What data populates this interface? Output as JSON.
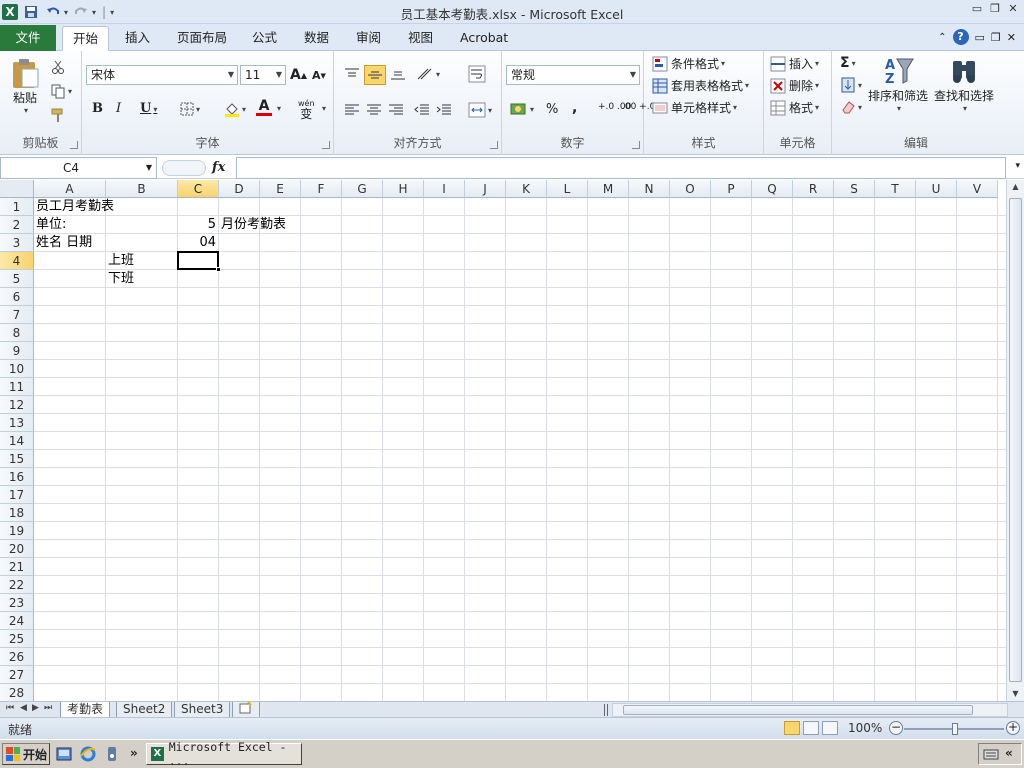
{
  "window": {
    "title": "员工基本考勤表.xlsx - Microsoft Excel"
  },
  "qat": {
    "app_icon": "X",
    "save_icon": "save-icon",
    "undo_icon": "undo-icon",
    "redo_icon": "redo-icon",
    "customize_icon": "customize-icon"
  },
  "tabs": {
    "file": "文件",
    "items": [
      "开始",
      "插入",
      "页面布局",
      "公式",
      "数据",
      "审阅",
      "视图",
      "Acrobat"
    ],
    "active": "开始"
  },
  "ribbon": {
    "clipboard": {
      "label": "剪贴板",
      "paste": "粘贴"
    },
    "font": {
      "label": "字体",
      "name": "宋体",
      "size": "11",
      "bold": "B",
      "italic": "I",
      "underline": "U",
      "grow": "A",
      "shrink": "A",
      "font_color_letter": "A",
      "wen": "wén",
      "wen_glyph": "变"
    },
    "alignment": {
      "label": "对齐方式"
    },
    "number": {
      "label": "数字",
      "format": "常规",
      "percent": "%",
      "comma": ",",
      "inc_dec": "+.0 .00",
      "dec_dec": ".00 +.0"
    },
    "styles": {
      "label": "样式",
      "conditional": "条件格式",
      "table": "套用表格格式",
      "cell_styles": "单元格样式"
    },
    "cells": {
      "label": "单元格",
      "insert": "插入",
      "delete": "删除",
      "format": "格式"
    },
    "editing": {
      "label": "编辑",
      "sigma": "Σ",
      "sort_filter": "排序和筛选",
      "find_select": "查找和选择",
      "az_a": "A",
      "az_z": "Z"
    }
  },
  "formula_bar": {
    "name_box": "C4",
    "fx": "fx",
    "value": ""
  },
  "grid": {
    "columns": [
      "A",
      "B",
      "C",
      "D",
      "E",
      "F",
      "G",
      "H",
      "I",
      "J",
      "K",
      "L",
      "M",
      "N",
      "O",
      "P",
      "Q",
      "R",
      "S",
      "T",
      "U",
      "V"
    ],
    "rows": [
      "1",
      "2",
      "3",
      "4",
      "5",
      "6",
      "7",
      "8",
      "9",
      "10",
      "11",
      "12",
      "13",
      "14",
      "15",
      "16",
      "17",
      "18",
      "19",
      "20",
      "21",
      "22",
      "23",
      "24",
      "25",
      "26",
      "27",
      "28"
    ],
    "selected_cell": "C4",
    "cells": {
      "A1": "员工月考勤表",
      "A2": "单位:",
      "C2": "5",
      "D2": "月份考勤表",
      "A3": "姓名   日期",
      "C3": "04",
      "B4": "上班",
      "B5": "下班"
    }
  },
  "sheets": {
    "tabs": [
      "考勤表",
      "Sheet2",
      "Sheet3"
    ],
    "active": "考勤表"
  },
  "status": {
    "ready": "就绪",
    "zoom": "100%",
    "zoom_minus": "−",
    "zoom_plus": "+"
  },
  "taskbar": {
    "start": "开始",
    "item": "Microsoft Excel - ...",
    "more": "»",
    "tray_more": "«"
  },
  "colors": {
    "file_tab": "#2a7a3c",
    "selected_header": "#f8d36e",
    "excel_green": "#1e7145"
  }
}
